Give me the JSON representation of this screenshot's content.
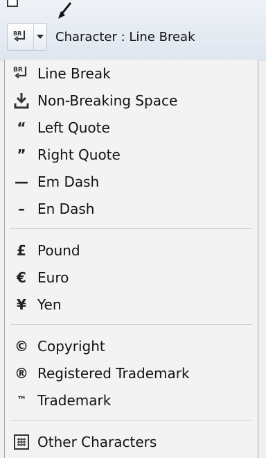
{
  "toolbar": {
    "button_text": "Character : Line Break"
  },
  "menu": {
    "items": [
      {
        "label": "Line Break",
        "icon": "line-break-icon"
      },
      {
        "label": "Non-Breaking Space",
        "icon": "non-breaking-space-icon"
      },
      {
        "label": "Left Quote",
        "icon": "left-quote-icon"
      },
      {
        "label": "Right Quote",
        "icon": "right-quote-icon"
      },
      {
        "label": "Em Dash",
        "icon": "em-dash-icon"
      },
      {
        "label": "En Dash",
        "icon": "en-dash-icon"
      },
      {
        "label": "Pound",
        "icon": "pound-icon"
      },
      {
        "label": "Euro",
        "icon": "euro-icon"
      },
      {
        "label": "Yen",
        "icon": "yen-icon"
      },
      {
        "label": "Copyright",
        "icon": "copyright-icon"
      },
      {
        "label": "Registered Trademark",
        "icon": "registered-trademark-icon"
      },
      {
        "label": "Trademark",
        "icon": "trademark-icon"
      },
      {
        "label": "Other Characters",
        "icon": "other-characters-icon"
      }
    ]
  },
  "icon_glyphs": {
    "left_quote": "“",
    "right_quote": "”",
    "em_dash": "—",
    "en_dash": "–",
    "pound": "£",
    "euro": "€",
    "yen": "¥",
    "copyright": "©",
    "registered": "®",
    "trademark": "™"
  }
}
